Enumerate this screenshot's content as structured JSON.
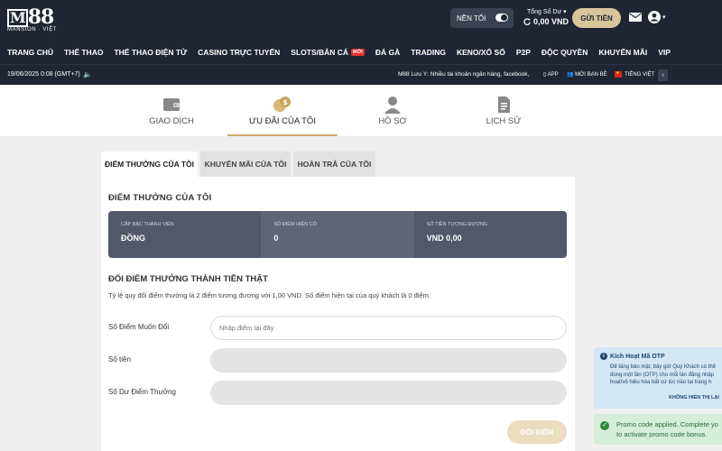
{
  "brand": {
    "logo_text": "M88",
    "logo_sub": "MANSION · VIỆT"
  },
  "header": {
    "mode_label": "NỀN TỐI",
    "balance_label": "Tổng Số Dư",
    "balance_value": "0,00 VND",
    "deposit_label": "GỬI TIỀN"
  },
  "nav": [
    {
      "label": "TRANG CHỦ"
    },
    {
      "label": "THỂ THAO"
    },
    {
      "label": "THỂ THAO ĐIỆN TỬ"
    },
    {
      "label": "CASINO TRỰC TUYẾN"
    },
    {
      "label": "SLOTS/BẮN CÁ",
      "badge": "MỚI"
    },
    {
      "label": "ĐÁ GÀ"
    },
    {
      "label": "TRADING"
    },
    {
      "label": "KENO/XỔ SỐ"
    },
    {
      "label": "P2P"
    },
    {
      "label": "ĐỘC QUYỀN"
    },
    {
      "label": "KHUYẾN MÃI"
    },
    {
      "label": "VIP"
    }
  ],
  "infobar": {
    "datetime": "19/06/2025 0:08 (GMT+7)",
    "ticker": "M88 Lưu Ý: Nhiều tài khoản ngân hàng, facebook, ",
    "app": "APP",
    "invite": "MỜI BẠN BÈ",
    "language": "TIẾNG VIỆT"
  },
  "account_tabs": [
    {
      "label": "GIAO DỊCH",
      "icon": "wallet-icon"
    },
    {
      "label": "ƯU ĐÃI CỦA TÔI",
      "icon": "coins-icon",
      "active": true
    },
    {
      "label": "HỒ SƠ",
      "icon": "profile-icon"
    },
    {
      "label": "LỊCH SỬ",
      "icon": "document-icon"
    }
  ],
  "sub_tabs": [
    {
      "label": "ĐIỂM THƯỞNG CỦA TÔI",
      "active": true
    },
    {
      "label": "KHUYẾN MÃI CỦA TÔI"
    },
    {
      "label": "HOÀN TRẢ CỦA TÔI"
    }
  ],
  "rewards": {
    "title": "ĐIỂM THƯỞNG CỦA TÔI",
    "summary": [
      {
        "key": "CẤP BẬC THÀNH VIÊN",
        "value": "ĐỒNG"
      },
      {
        "key": "SỐ ĐIỂM HIỆN CÓ",
        "value": "0"
      },
      {
        "key": "SỐ TIỀN TƯƠNG ĐƯƠNG",
        "value": "VND 0,00"
      }
    ],
    "convert_title": "ĐỔI ĐIỂM THƯỞNG THÀNH TIỀN THẬT",
    "convert_desc": "Tỷ lệ quy đổi điểm thưởng là 2 điểm tương đương với 1,00 VND. Số điểm hiện tại của quý khách là 0 điểm.",
    "fields": [
      {
        "label": "Số Điểm Muốn Đổi",
        "placeholder": "Nhập điểm tại đây",
        "value": ""
      },
      {
        "label": "Số tiền",
        "placeholder": "",
        "value": ""
      },
      {
        "label": "Số Dư Điểm Thưởng",
        "placeholder": "",
        "value": ""
      }
    ],
    "redeem_label": "ĐỔI ĐIỂM"
  },
  "toasts": {
    "otp": {
      "title": "Kích Hoạt Mã OTP",
      "line1": "Để tăng bảo mật, bây giờ Quý Khách có thể",
      "line2": "dùng một lần (OTP) cho mỗi lần đăng nhập",
      "line3": "hoạt/vô hiệu hóa bất cứ lúc nào tại trang h",
      "dismiss": "KHÔNG HIỂN THỊ LẠI"
    },
    "promo": {
      "line1": "Promo code applied. Complete yo",
      "line2": "to activate promo code bonus."
    }
  },
  "colors": {
    "header_bg": "#1f2533",
    "accent_gold": "#d9c59a",
    "summary_bg": "#52586a"
  }
}
